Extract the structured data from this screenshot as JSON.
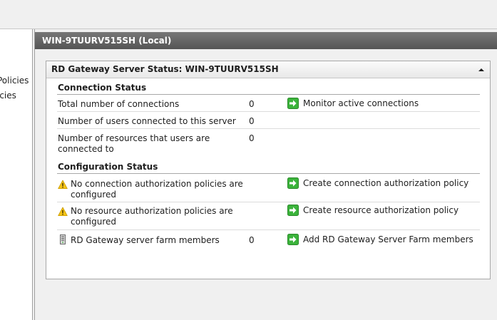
{
  "tree": {
    "items": [
      "Policies",
      "icies"
    ]
  },
  "main": {
    "header": "WIN-9TUURV515SH (Local)"
  },
  "panel": {
    "title": "RD Gateway Server Status: WIN-9TUURV515SH",
    "connection_status": {
      "title": "Connection Status",
      "rows": [
        {
          "label": "Total number of connections",
          "value": "0",
          "action": "Monitor active connections"
        },
        {
          "label": "Number of users connected to this server",
          "value": "0"
        },
        {
          "label": "Number of resources that users are connected to",
          "value": "0"
        }
      ]
    },
    "configuration_status": {
      "title": "Configuration Status",
      "rows": [
        {
          "icon": "warning-icon",
          "label": "No connection authorization policies are configured",
          "action": "Create connection authorization policy"
        },
        {
          "icon": "warning-icon",
          "label": "No resource authorization policies are configured",
          "action": "Create resource authorization policy"
        },
        {
          "icon": "server-farm-icon",
          "label": "RD Gateway server farm members",
          "value": "0",
          "action": "Add RD Gateway Server Farm members"
        }
      ]
    }
  },
  "colors": {
    "header_bg": "#666666",
    "action_green": "#3bb33b",
    "warning_yellow": "#f5c518"
  }
}
